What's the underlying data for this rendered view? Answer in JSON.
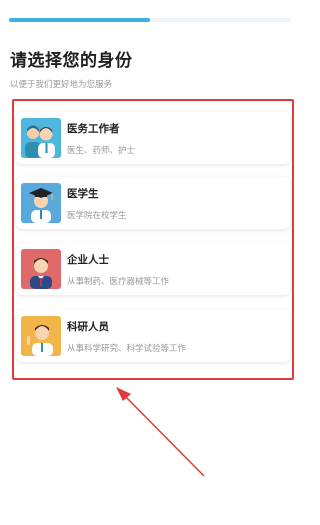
{
  "progress": {
    "fraction": 0.5
  },
  "header": {
    "title": "请选择您的身份",
    "subtitle": "以便于我们更好地为您服务"
  },
  "options": [
    {
      "title": "医务工作者",
      "desc": "医生、药师、护士",
      "icon": "medical-staff-icon",
      "bg": "#4fb6e0"
    },
    {
      "title": "医学生",
      "desc": "医学院在校学生",
      "icon": "medical-student-icon",
      "bg": "#5aa9dd"
    },
    {
      "title": "企业人士",
      "desc": "从事制药、医疗器械等工作",
      "icon": "business-person-icon",
      "bg": "#e06a6a"
    },
    {
      "title": "科研人员",
      "desc": "从事科学研究、科学试验等工作",
      "icon": "researcher-icon",
      "bg": "#f2b54a"
    }
  ],
  "colors": {
    "accent": "#3db3e5",
    "annotation": "#e23a3a"
  }
}
